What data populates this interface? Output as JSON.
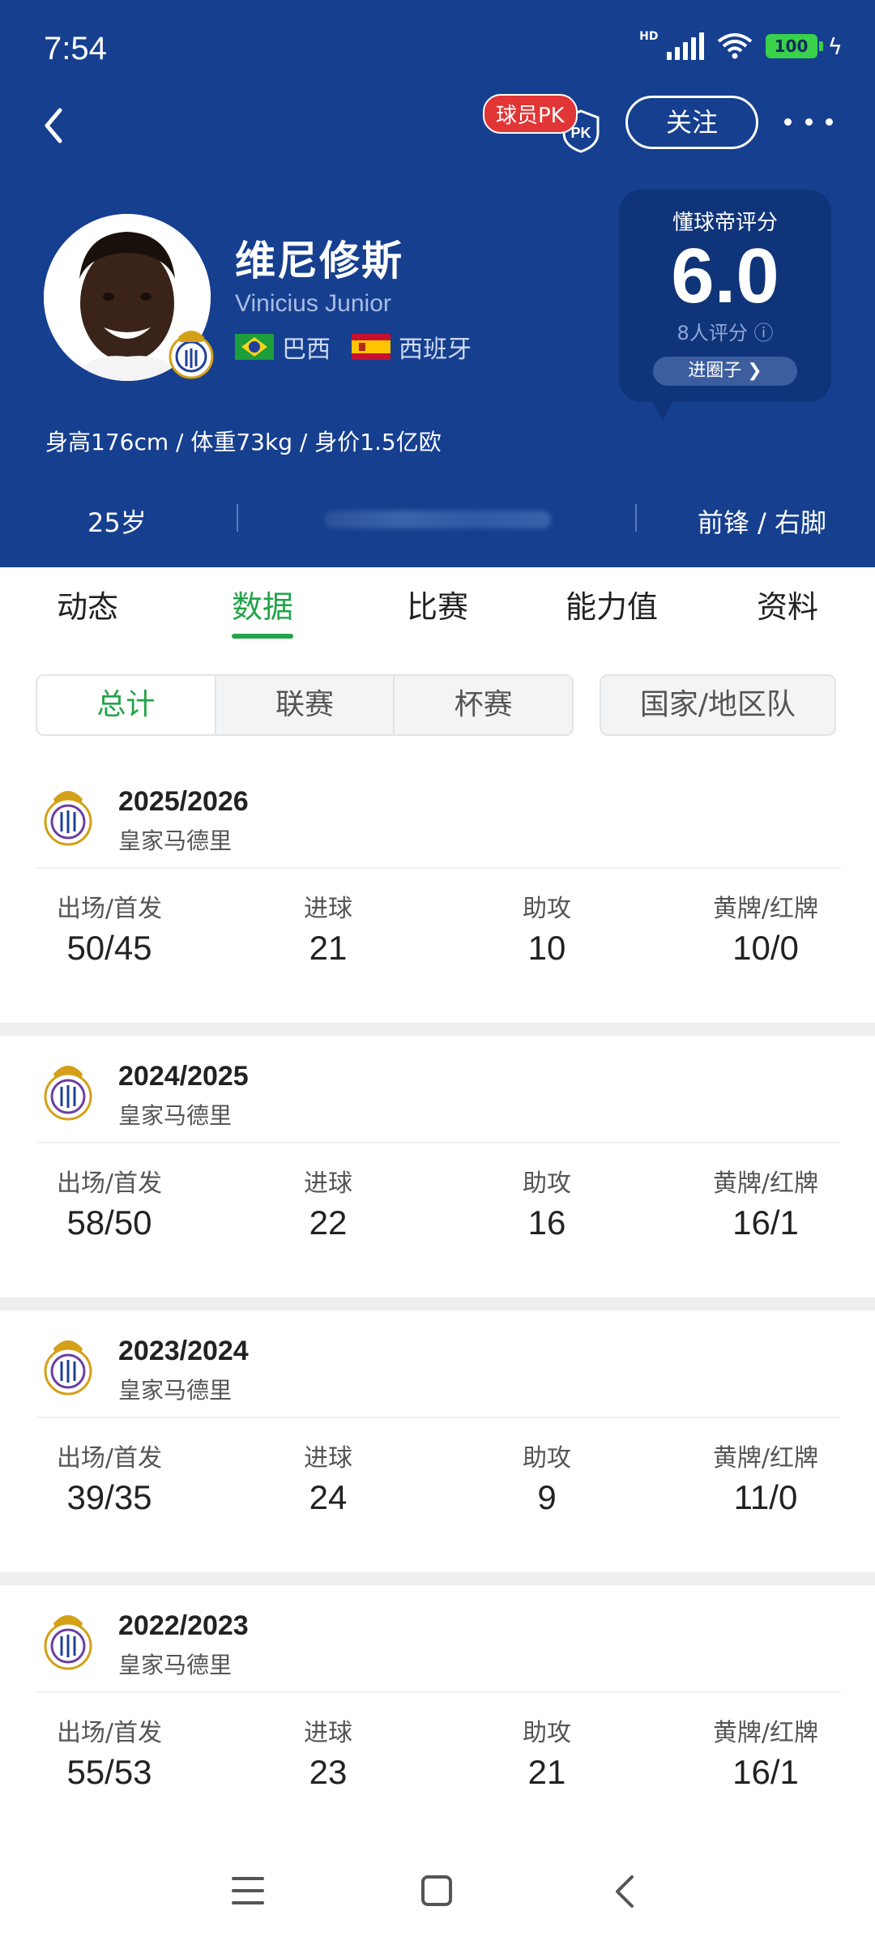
{
  "status": {
    "time": "7:54",
    "network": "HD",
    "battery": "100"
  },
  "nav": {
    "pk_label": "球员PK",
    "pk_badge": "PK",
    "follow_label": "关注"
  },
  "player": {
    "name": "维尼修斯",
    "english_name": "Vinicius Junior",
    "nationalities": [
      "巴西",
      "西班牙"
    ],
    "body_info": "身高176cm / 体重73kg / 身价1.5亿欧",
    "age": "25岁",
    "position": "前锋 / 右脚"
  },
  "rating": {
    "label": "懂球帝评分",
    "score": "6.0",
    "count": "8人评分 ⓘ",
    "circle_label": "进圈子 ❯"
  },
  "tabs": [
    "动态",
    "数据",
    "比赛",
    "能力值",
    "资料"
  ],
  "active_tab": "数据",
  "filters": {
    "segments": [
      "总计",
      "联赛",
      "杯赛"
    ],
    "active": "总计",
    "national": "国家/地区队"
  },
  "stat_labels": {
    "apps": "出场/首发",
    "goals": "进球",
    "assists": "助攻",
    "cards": "黄牌/红牌"
  },
  "seasons": [
    {
      "year": "2025/2026",
      "club": "皇家马德里",
      "apps": "50/45",
      "goals": "21",
      "assists": "10",
      "cards": "10/0"
    },
    {
      "year": "2024/2025",
      "club": "皇家马德里",
      "apps": "58/50",
      "goals": "22",
      "assists": "16",
      "cards": "16/1"
    },
    {
      "year": "2023/2024",
      "club": "皇家马德里",
      "apps": "39/35",
      "goals": "24",
      "assists": "9",
      "cards": "11/0"
    },
    {
      "year": "2022/2023",
      "club": "皇家马德里",
      "apps": "55/53",
      "goals": "23",
      "assists": "21",
      "cards": "16/1"
    }
  ],
  "colors": {
    "header_bg": "#163f8f",
    "accent_green": "#22a44a",
    "rating_bg": "#0f3479"
  }
}
